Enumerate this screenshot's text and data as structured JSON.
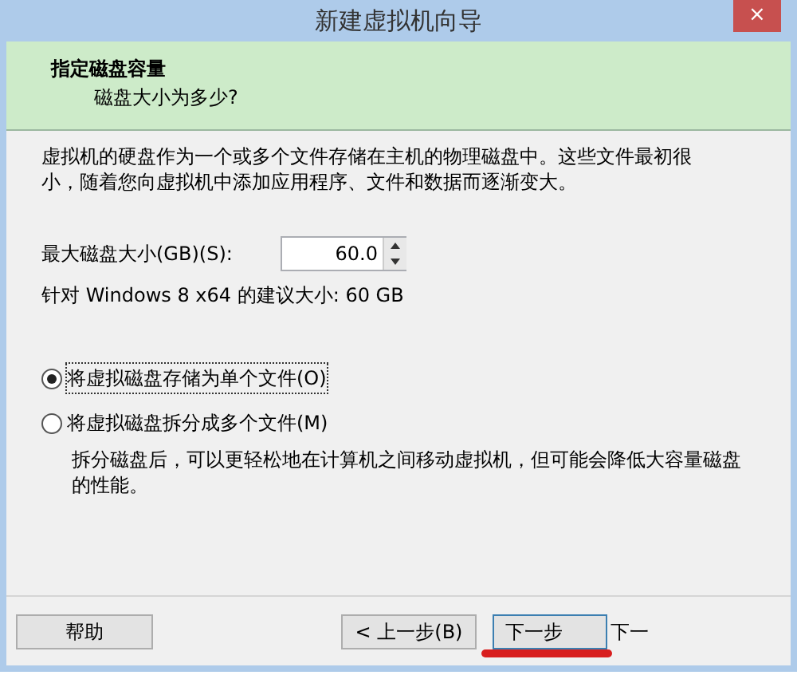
{
  "window": {
    "title": "新建虚拟机向导",
    "close": "×"
  },
  "header": {
    "title": "指定磁盘容量",
    "subtitle": "磁盘大小为多少?"
  },
  "description": "虚拟机的硬盘作为一个或多个文件存储在主机的物理磁盘中。这些文件最初很小，随着您向虚拟机中添加应用程序、文件和数据而逐渐变大。",
  "disk_size": {
    "label": "最大磁盘大小(GB)(S):",
    "value": "60.0"
  },
  "recommendation": "针对 Windows 8 x64 的建议大小: 60 GB",
  "options": [
    {
      "label": "将虚拟磁盘存储为单个文件(O)",
      "selected": true
    },
    {
      "label": "将虚拟磁盘拆分成多个文件(M)",
      "selected": false,
      "note": "拆分磁盘后，可以更轻松地在计算机之间移动虚拟机，但可能会降低大容量磁盘的性能。"
    }
  ],
  "buttons": [
    {
      "kind": "help",
      "label": "帮助"
    },
    {
      "kind": "back",
      "label": "< 上一步(B)"
    },
    {
      "kind": "next",
      "label": "下一步",
      "overlap": "下一"
    }
  ]
}
